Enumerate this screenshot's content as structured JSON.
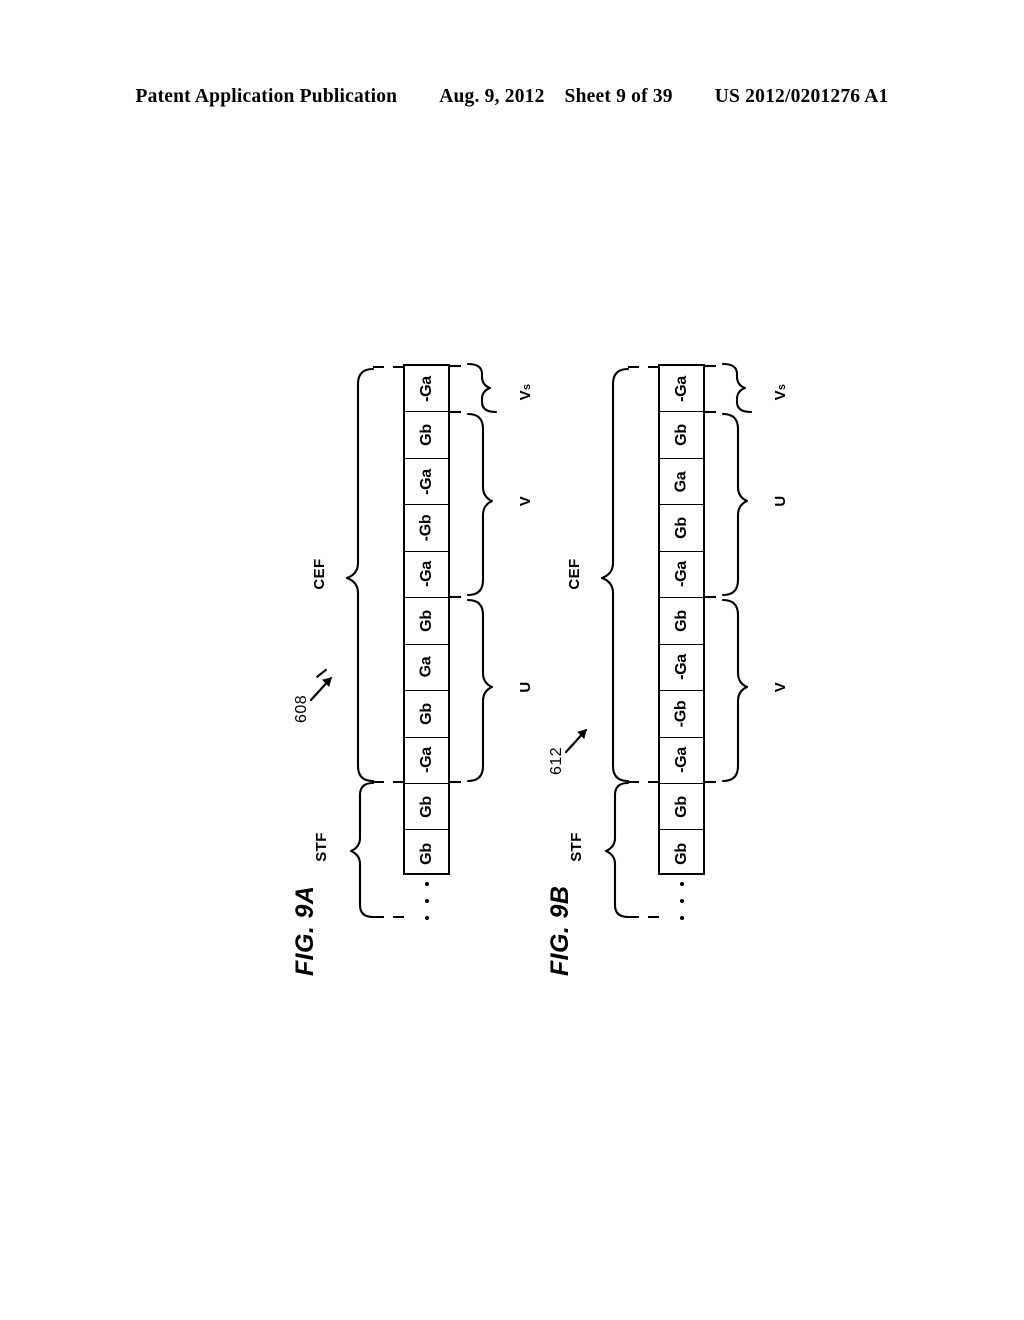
{
  "header": {
    "publication": "Patent Application Publication",
    "date": "Aug. 9, 2012",
    "sheet": "Sheet 9 of 39",
    "patent_number": "US 2012/0201276 A1"
  },
  "figures": [
    {
      "id": "9a",
      "caption": "FIG. 9A",
      "reference_numeral": "608",
      "left_braces": [
        {
          "label": "CEF",
          "name": "cef"
        },
        {
          "label": "STF",
          "name": "stf"
        }
      ],
      "right_braces": [
        {
          "label": "V",
          "subscript": "s",
          "name": "vs"
        },
        {
          "label": "V",
          "subscript": "",
          "name": "v"
        },
        {
          "label": "U",
          "subscript": "",
          "name": "u"
        }
      ],
      "cells": [
        {
          "label": "-Ga"
        },
        {
          "label": "Gb"
        },
        {
          "label": "-Ga"
        },
        {
          "label": "-Gb"
        },
        {
          "label": "-Ga"
        },
        {
          "label": "Gb"
        },
        {
          "label": "Ga"
        },
        {
          "label": "Gb"
        },
        {
          "label": "-Ga"
        },
        {
          "label": "Gb"
        },
        {
          "label": "Gb"
        }
      ],
      "ellipsis": "⋮"
    },
    {
      "id": "9b",
      "caption": "FIG. 9B",
      "reference_numeral": "612",
      "left_braces": [
        {
          "label": "CEF",
          "name": "cef"
        },
        {
          "label": "STF",
          "name": "stf"
        }
      ],
      "right_braces": [
        {
          "label": "V",
          "subscript": "s",
          "name": "vs"
        },
        {
          "label": "U",
          "subscript": "",
          "name": "u"
        },
        {
          "label": "V",
          "subscript": "",
          "name": "v"
        }
      ],
      "cells": [
        {
          "label": "-Ga"
        },
        {
          "label": "Gb"
        },
        {
          "label": "Ga"
        },
        {
          "label": "Gb"
        },
        {
          "label": "-Ga"
        },
        {
          "label": "Gb"
        },
        {
          "label": "-Ga"
        },
        {
          "label": "-Gb"
        },
        {
          "label": "-Ga"
        },
        {
          "label": "Gb"
        },
        {
          "label": "Gb"
        }
      ],
      "ellipsis": "⋮"
    }
  ]
}
